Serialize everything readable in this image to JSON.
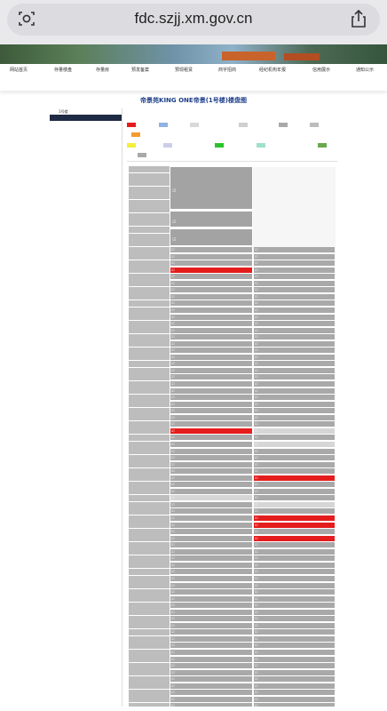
{
  "browser": {
    "url": "fdc.szjj.xm.gov.cn"
  },
  "nav": {
    "items": [
      "网站首页",
      "存量楼盘",
      "存量房",
      "预发备案",
      "预现租赁",
      "商字招商",
      "经纪机构年报",
      "信用展示",
      "通知公示"
    ]
  },
  "page_title": "帝景苑KING ONE帝景(1号楼)楼盘图",
  "tree": {
    "root": "1号楼",
    "selected": "",
    "sub": ""
  },
  "legend": [
    {
      "color": "#e51c1c",
      "label": ""
    },
    {
      "color": "#8fb4e3",
      "label": ""
    },
    {
      "color": "#d9d9d9",
      "label": ""
    },
    {
      "color": "#cfcfcf",
      "label": ""
    },
    {
      "color": "#a9a9a9",
      "label": ""
    },
    {
      "color": "#bdbdbd",
      "label": ""
    },
    {
      "color": "#f39b2f",
      "label": ""
    },
    {
      "color": "#f4ee3c",
      "label": ""
    },
    {
      "color": "#cccceb",
      "label": ""
    },
    {
      "color": "#2cc22c",
      "label": ""
    },
    {
      "color": "#9fe0cc",
      "label": ""
    },
    {
      "color": "#6aa84f",
      "label": ""
    },
    {
      "color": "#a9a9a9",
      "label": ""
    }
  ],
  "floors": [
    "",
    "",
    "",
    "",
    "",
    "",
    "",
    "",
    "",
    "",
    "",
    "",
    "",
    "",
    "",
    "",
    "",
    "",
    "",
    "",
    "",
    "",
    "",
    "",
    "",
    "",
    "",
    "",
    "",
    "",
    "",
    "",
    "",
    "",
    "",
    "",
    "",
    "",
    "",
    "",
    "",
    "",
    "",
    "",
    "",
    "",
    "",
    "",
    "",
    "",
    "",
    "",
    "",
    "",
    "",
    "",
    "",
    "",
    "",
    "",
    "",
    "",
    "",
    "",
    "",
    "",
    "",
    "",
    "",
    "",
    "",
    "",
    "",
    "",
    "",
    "",
    "",
    "",
    "",
    "",
    "",
    "",
    "",
    "",
    "",
    "",
    "",
    ""
  ],
  "units_b": [
    "",
    "",
    "",
    "",
    "",
    "",
    "",
    "",
    "",
    "",
    "",
    "",
    "",
    "",
    "",
    "",
    "",
    "",
    "",
    "",
    "",
    "",
    "",
    "",
    "",
    "",
    "",
    "",
    "",
    "",
    "",
    "",
    "",
    "",
    "",
    "",
    "",
    "",
    "",
    "",
    "",
    "",
    "",
    "",
    "",
    "",
    "",
    "",
    "",
    "",
    "",
    "",
    "",
    "",
    "",
    "",
    "",
    "",
    "",
    "",
    "",
    "",
    "",
    "",
    "",
    "",
    "",
    "",
    "",
    "",
    "",
    "",
    "",
    "",
    "",
    "",
    ""
  ],
  "units_c": [
    "",
    "",
    "",
    "",
    "",
    "",
    "",
    "",
    "",
    "",
    "",
    "",
    "",
    "",
    "",
    "",
    "",
    "",
    "",
    "",
    "",
    "",
    "",
    "",
    "",
    "",
    "",
    "",
    "",
    "",
    "",
    "",
    "",
    "",
    "",
    "",
    "",
    "",
    "",
    "",
    "",
    "",
    "",
    "",
    "",
    "",
    "",
    "",
    "",
    "",
    "",
    "",
    "",
    "",
    "",
    "",
    "",
    "",
    "",
    "",
    "",
    "",
    "",
    "",
    "",
    "",
    "",
    "",
    "",
    "",
    "",
    "",
    "",
    "",
    "",
    "",
    ""
  ],
  "red_b": [
    3,
    27
  ],
  "red_c": [
    34,
    40,
    41,
    43
  ],
  "light_b": [
    37
  ],
  "light_c": [
    27,
    29,
    38
  ]
}
